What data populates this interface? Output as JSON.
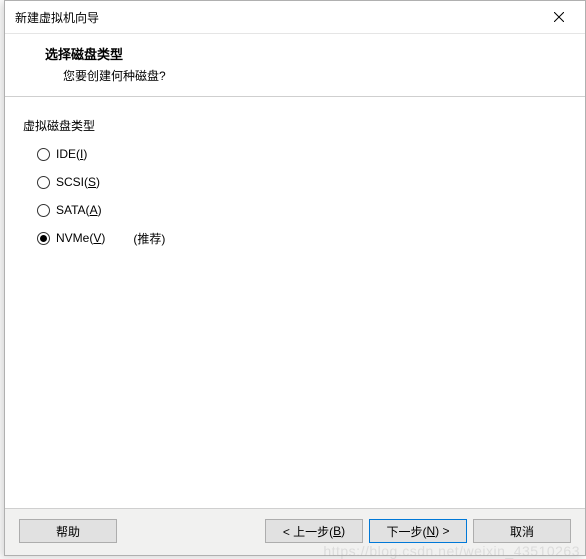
{
  "window": {
    "title": "新建虚拟机向导"
  },
  "header": {
    "title": "选择磁盘类型",
    "subtitle": "您要创建何种磁盘?"
  },
  "group": {
    "label": "虚拟磁盘类型",
    "options": [
      {
        "pre": "IDE(",
        "mn": "I",
        "post": ")",
        "selected": false
      },
      {
        "pre": "SCSI(",
        "mn": "S",
        "post": ")",
        "selected": false
      },
      {
        "pre": "SATA(",
        "mn": "A",
        "post": ")",
        "selected": false
      },
      {
        "pre": "NVMe(",
        "mn": "V",
        "post": ")",
        "selected": true,
        "hint": "(推荐)"
      }
    ]
  },
  "buttons": {
    "help": "帮助",
    "back": {
      "pre": "< 上一步(",
      "mn": "B",
      "post": ")"
    },
    "next": {
      "pre": "下一步(",
      "mn": "N",
      "post": ") >"
    },
    "cancel": "取消"
  },
  "watermark": "https://blog.csdn.net/weixin_43510263"
}
